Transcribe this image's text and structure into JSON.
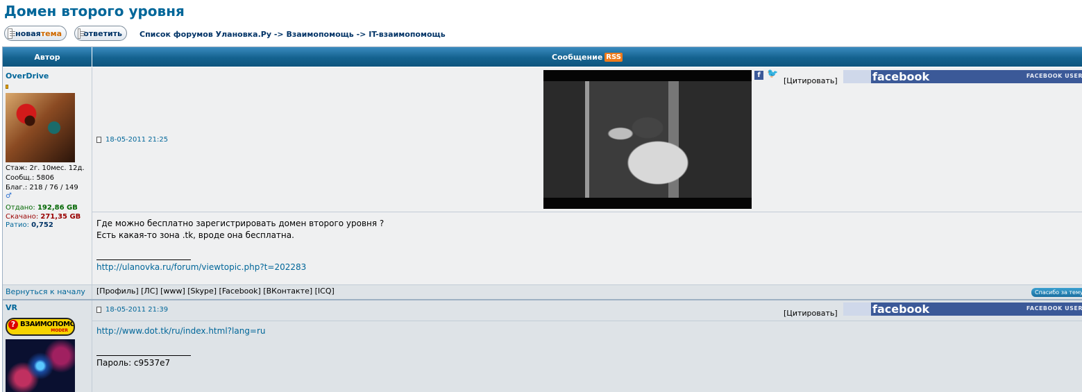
{
  "topic": {
    "title": "Домен второго уровня"
  },
  "toolbar": {
    "new_topic_a": "новая ",
    "new_topic_b": "тема",
    "reply": "ответить"
  },
  "breadcrumb": {
    "forums": "Список форумов Улановка.Ру",
    "sep": "->",
    "mutual_help": "Взаимопомощь",
    "it_help": "IT-взаимопомощь"
  },
  "table": {
    "header_author": "Автор",
    "header_message": "Сообщение",
    "rss": "RSS"
  },
  "posts": [
    {
      "author": "OverDrive",
      "stats": {
        "tenure": "Стаж: 2г. 10мес. 12д.",
        "messages": "Сообщ.: 5806",
        "thanks": "Благ.: 218 / 76 / 149",
        "uploaded_label": "Отдано: ",
        "uploaded": "192,86 GB",
        "downloaded_label": "Скачано: ",
        "downloaded": "271,35 GB",
        "ratio_label": "Ратио: ",
        "ratio": "0,752",
        "gender_icon": "male-icon"
      },
      "date": "18-05-2011 21:25",
      "quote": "[Цитировать]",
      "body_line1": "Где можно бесплатно зарегистрировать домен второго уровня ?",
      "body_line2": "Есть какая-то зона .tk, вроде она бесплатна.",
      "signature": "http://ulanovka.ru/forum/viewtopic.php?t=202283",
      "back_to_top": "Вернуться к началу",
      "profile_links": "[Профиль]  [ЛС]  [www]  [Skype]  [Facebook]  [ВКонтакте]  [ICQ]",
      "thanks_button": "Спасибо за тему"
    },
    {
      "author": "VR",
      "badge_main": "ВЗАИМОПОМОЩЬ",
      "badge_sub": "MODER",
      "date": "18-05-2011 21:39",
      "quote": "[Цитировать]",
      "body_line1": "http://www.dot.tk/ru/index.html?lang=ru",
      "signature": "Пароль: c9537e7"
    }
  ],
  "facebook": {
    "logo": "facebook",
    "small": "FACEBOOK USER"
  },
  "share": {
    "fb": "f",
    "tw": "🐦"
  }
}
